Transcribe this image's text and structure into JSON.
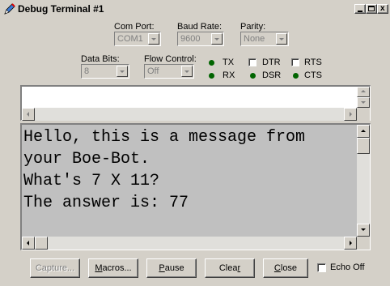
{
  "window": {
    "title": "Debug Terminal #1"
  },
  "settings": {
    "com_port": {
      "label": "Com Port:",
      "value": "COM1"
    },
    "baud_rate": {
      "label": "Baud Rate:",
      "value": "9600"
    },
    "parity": {
      "label": "Parity:",
      "value": "None"
    },
    "data_bits": {
      "label": "Data Bits:",
      "value": "8"
    },
    "flow_control": {
      "label": "Flow Control:",
      "value": "Off"
    }
  },
  "indicators": {
    "tx": "TX",
    "rx": "RX",
    "dtr": "DTR",
    "rts": "RTS",
    "dsr": "DSR",
    "cts": "CTS",
    "led_color": "#006400"
  },
  "terminal": {
    "lines": [
      "Hello, this is a message from",
      "your Boe-Bot.",
      "What's 7 X 11?",
      "The answer is: 77"
    ]
  },
  "buttons": {
    "capture": {
      "pre": "",
      "u": "",
      "post": "Capture..."
    },
    "macros": {
      "pre": "",
      "u": "M",
      "post": "acros..."
    },
    "pause": {
      "pre": "",
      "u": "P",
      "post": "ause"
    },
    "clear": {
      "pre": "Clea",
      "u": "r",
      "post": ""
    },
    "close": {
      "pre": "",
      "u": "C",
      "post": "lose"
    },
    "echo_off": "Echo Off"
  }
}
